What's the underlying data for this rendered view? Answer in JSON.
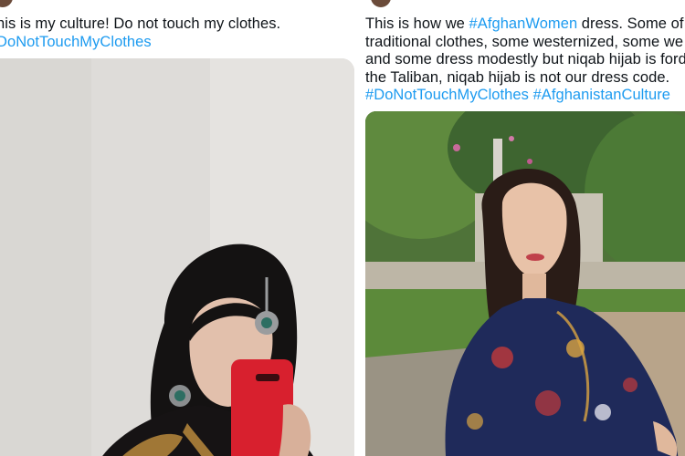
{
  "tweets": [
    {
      "id": "left",
      "lines": [
        [
          {
            "text": "his is my culture! Do not touch my clothes.",
            "tag": false
          }
        ],
        [
          {
            "text": "DoNotTouchMyClothes",
            "tag": true
          }
        ]
      ],
      "media": {
        "description_icon": "photo-icon"
      }
    },
    {
      "id": "right",
      "lines": [
        [
          {
            "text": "This is how we ",
            "tag": false
          },
          {
            "text": "#AfghanWomen",
            "tag": true
          },
          {
            "text": " dress. Some of",
            "tag": false
          }
        ],
        [
          {
            "text": "traditional clothes, some westernized, some we",
            "tag": false
          }
        ],
        [
          {
            "text": "and some dress modestly but niqab hijab is ford",
            "tag": false
          }
        ],
        [
          {
            "text": "the Taliban, niqab hijab is not our dress code.",
            "tag": false
          }
        ],
        [
          {
            "text": "#DoNotTouchMyClothes",
            "tag": true
          },
          {
            "text": " ",
            "tag": false
          },
          {
            "text": "#AfghanistanCulture",
            "tag": true
          }
        ]
      ],
      "media": {
        "description_icon": "photo-icon"
      }
    }
  ],
  "colors": {
    "hashtag": "#1d9bf0",
    "text": "#0f1419",
    "background": "#ffffff"
  }
}
